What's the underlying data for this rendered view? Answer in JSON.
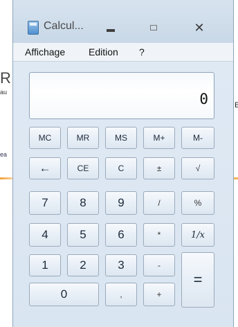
{
  "background": {
    "fragments": [
      "R",
      "au",
      "ea",
      "E"
    ]
  },
  "window": {
    "title": "Calcul...",
    "icon": "calculator-icon",
    "controls": {
      "minimize": "minimize-icon",
      "maximize": "maximize-icon",
      "close": "✕"
    }
  },
  "menu": {
    "items": [
      "Affichage",
      "Edition",
      "?"
    ]
  },
  "display": {
    "value": "0"
  },
  "keys": {
    "memory": [
      "MC",
      "MR",
      "MS",
      "M+",
      "M-"
    ],
    "row2": [
      "←",
      "CE",
      "C",
      "±",
      "√"
    ],
    "row3": [
      "7",
      "8",
      "9",
      "/",
      "%"
    ],
    "row4": [
      "4",
      "5",
      "6",
      "*",
      "1/x"
    ],
    "row5": [
      "1",
      "2",
      "3",
      "-"
    ],
    "equals": "=",
    "row6": [
      "0",
      ",",
      "+"
    ]
  }
}
